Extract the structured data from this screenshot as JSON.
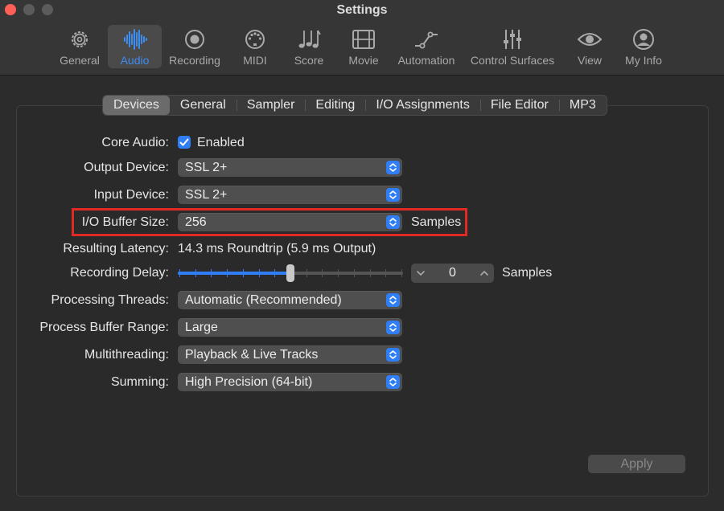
{
  "window": {
    "title": "Settings"
  },
  "toolbar": {
    "items": [
      {
        "label": "General",
        "icon": "gear-icon"
      },
      {
        "label": "Audio",
        "icon": "waveform-icon",
        "active": true
      },
      {
        "label": "Recording",
        "icon": "record-icon"
      },
      {
        "label": "MIDI",
        "icon": "midi-port-icon"
      },
      {
        "label": "Score",
        "icon": "music-notes-icon"
      },
      {
        "label": "Movie",
        "icon": "film-icon"
      },
      {
        "label": "Automation",
        "icon": "automation-curve-icon"
      },
      {
        "label": "Control Surfaces",
        "icon": "faders-icon"
      },
      {
        "label": "View",
        "icon": "eye-icon"
      },
      {
        "label": "My Info",
        "icon": "person-icon"
      }
    ]
  },
  "tabs": [
    "Devices",
    "General",
    "Sampler",
    "Editing",
    "I/O Assignments",
    "File Editor",
    "MP3"
  ],
  "form": {
    "core_audio": {
      "label": "Core Audio:",
      "checkbox_label": "Enabled",
      "checked": true
    },
    "output_device": {
      "label": "Output Device:",
      "value": "SSL 2+"
    },
    "input_device": {
      "label": "Input Device:",
      "value": "SSL 2+"
    },
    "io_buffer": {
      "label": "I/O Buffer Size:",
      "value": "256",
      "unit": "Samples"
    },
    "latency": {
      "label": "Resulting Latency:",
      "value": "14.3 ms Roundtrip (5.9 ms Output)"
    },
    "recording_delay": {
      "label": "Recording Delay:",
      "value": "0",
      "unit": "Samples",
      "slider_fraction": 0.5
    },
    "processing_threads": {
      "label": "Processing Threads:",
      "value": "Automatic (Recommended)"
    },
    "process_buffer": {
      "label": "Process Buffer Range:",
      "value": "Large"
    },
    "multithreading": {
      "label": "Multithreading:",
      "value": "Playback & Live Tracks"
    },
    "summing": {
      "label": "Summing:",
      "value": "High Precision (64-bit)"
    }
  },
  "apply_label": "Apply",
  "colors": {
    "accent": "#2f7ef6",
    "highlight_box": "#e02a23",
    "close_button": "#fe5f57"
  }
}
